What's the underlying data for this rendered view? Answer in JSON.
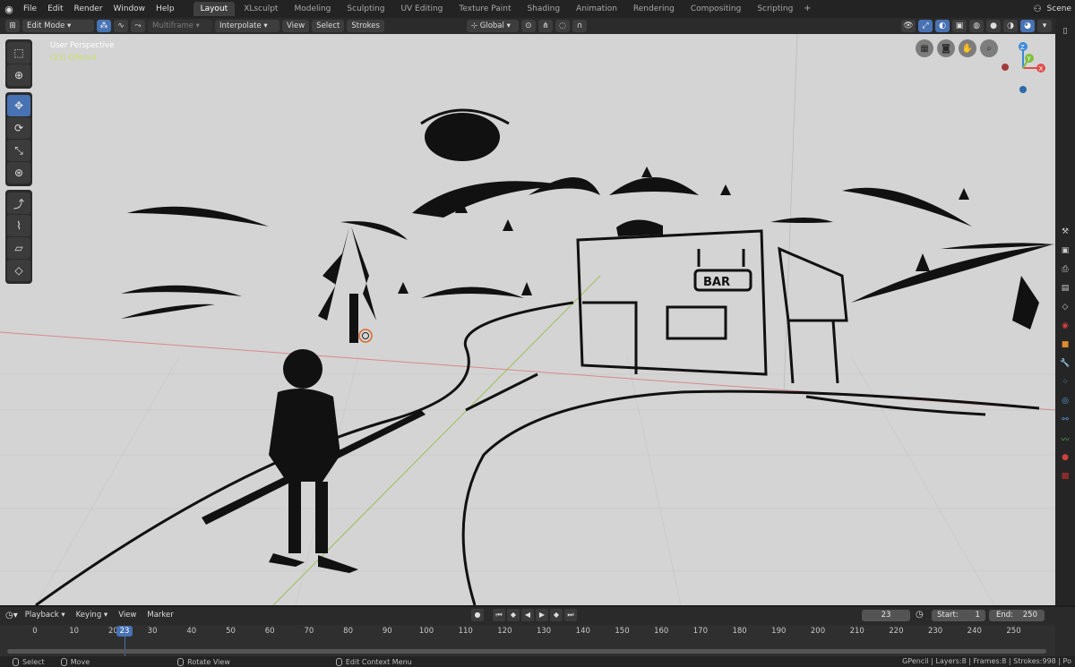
{
  "menubar": {
    "items": [
      "File",
      "Edit",
      "Render",
      "Window",
      "Help"
    ],
    "workspaces": [
      "Layout",
      "XLsculpt",
      "Modeling",
      "Sculpting",
      "UV Editing",
      "Texture Paint",
      "Shading",
      "Animation",
      "Rendering",
      "Compositing",
      "Scripting"
    ],
    "add_workspace": "+",
    "scene_name": "Scene"
  },
  "viewport_header": {
    "mode": "Edit Mode",
    "multiframe": "Multiframe",
    "interpolate": "Interpolate",
    "menus": [
      "View",
      "Select",
      "Strokes"
    ],
    "orientation": "Global"
  },
  "viewport": {
    "perspective_label": "User Perspective",
    "object_label": "(23) GPencil",
    "gizmo_axes": [
      "Z",
      "Y",
      "X"
    ]
  },
  "timeline": {
    "menus": [
      "Playback",
      "Keying",
      "View",
      "Marker"
    ],
    "current_frame": "23",
    "start_label": "Start:",
    "start_value": "1",
    "end_label": "End:",
    "end_value": "250",
    "ticks": [
      "0",
      "10",
      "20",
      "30",
      "40",
      "50",
      "60",
      "70",
      "80",
      "90",
      "100",
      "110",
      "120",
      "130",
      "140",
      "150",
      "160",
      "170",
      "180",
      "190",
      "200",
      "210",
      "220",
      "230",
      "240",
      "250"
    ],
    "playhead_label": "23"
  },
  "statusbar": {
    "select": "Select",
    "move": "Move",
    "rotate_view": "Rotate View",
    "context_menu": "Edit Context Menu",
    "stats": "GPencil | Layers:8 | Frames:8 | Strokes:998 | Po"
  }
}
